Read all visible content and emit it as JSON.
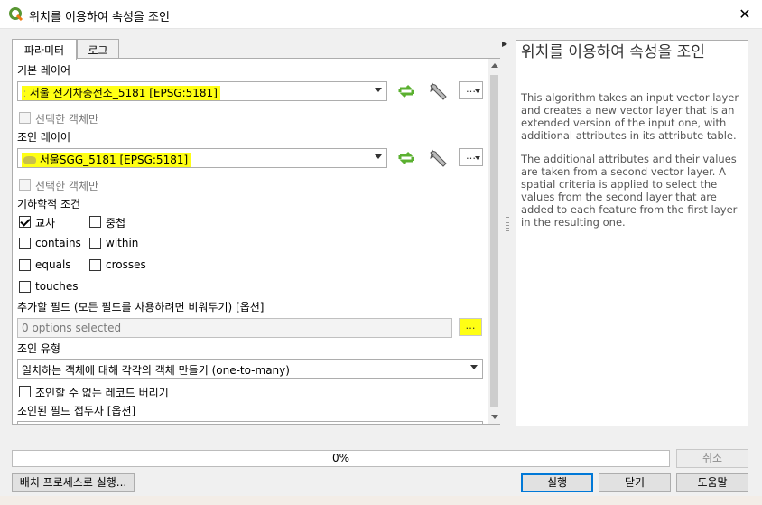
{
  "window": {
    "title": "위치를 이용하여 속성을 조인",
    "close_label": "✕"
  },
  "tabs": [
    {
      "label": "파라미터",
      "active": true
    },
    {
      "label": "로그",
      "active": false
    }
  ],
  "params": {
    "base_layer_label": "기본 레이어",
    "base_layer_value": "서울 전기차충전소_5181 [EPSG:5181]",
    "base_selected_only": "선택한 객체만",
    "join_layer_label": "조인 레이어",
    "join_layer_value": "서울SGG_5181 [EPSG:5181]",
    "join_selected_only": "선택한 객체만",
    "geometric_predicate_label": "기하학적 조건",
    "predicates": {
      "intersects": {
        "label": "교차",
        "checked": true
      },
      "overlaps": {
        "label": "중첩",
        "checked": false
      },
      "contains": {
        "label": "contains",
        "checked": false
      },
      "within": {
        "label": "within",
        "checked": false
      },
      "equals": {
        "label": "equals",
        "checked": false
      },
      "crosses": {
        "label": "crosses",
        "checked": false
      },
      "touches": {
        "label": "touches",
        "checked": false
      }
    },
    "fields_label": "추가할 필드 (모든 필드를 사용하려면 비워두기) [옵션]",
    "fields_placeholder": "0 options selected",
    "join_type_label": "조인 유형",
    "join_type_value": "일치하는 객체에 대해 각각의 객체 만들기 (one-to-many)",
    "discard_label": "조인할 수 없는 레코드 버리기",
    "prefix_label": "조인된 필드 접두사 [옵션]",
    "dots": "…"
  },
  "help": {
    "title": "위치를 이용하여 속성을 조인",
    "p1": "This algorithm takes an input vector layer and creates a new vector layer that is an extended version of the input one, with additional attributes in its attribute table.",
    "p2": "The additional attributes and their values are taken from a second vector layer. A spatial criteria is applied to select the values from the second layer that are added to each feature from the first layer in the resulting one."
  },
  "progress": {
    "value": 0,
    "text": "0%"
  },
  "buttons": {
    "cancel": "취소",
    "batch": "배치 프로세스로 실행...",
    "run": "실행",
    "close": "닫기",
    "help": "도움말"
  },
  "colors": {
    "highlight": "#ffff14",
    "accent": "#0078d7",
    "refresh_icon": "#5bb030"
  }
}
